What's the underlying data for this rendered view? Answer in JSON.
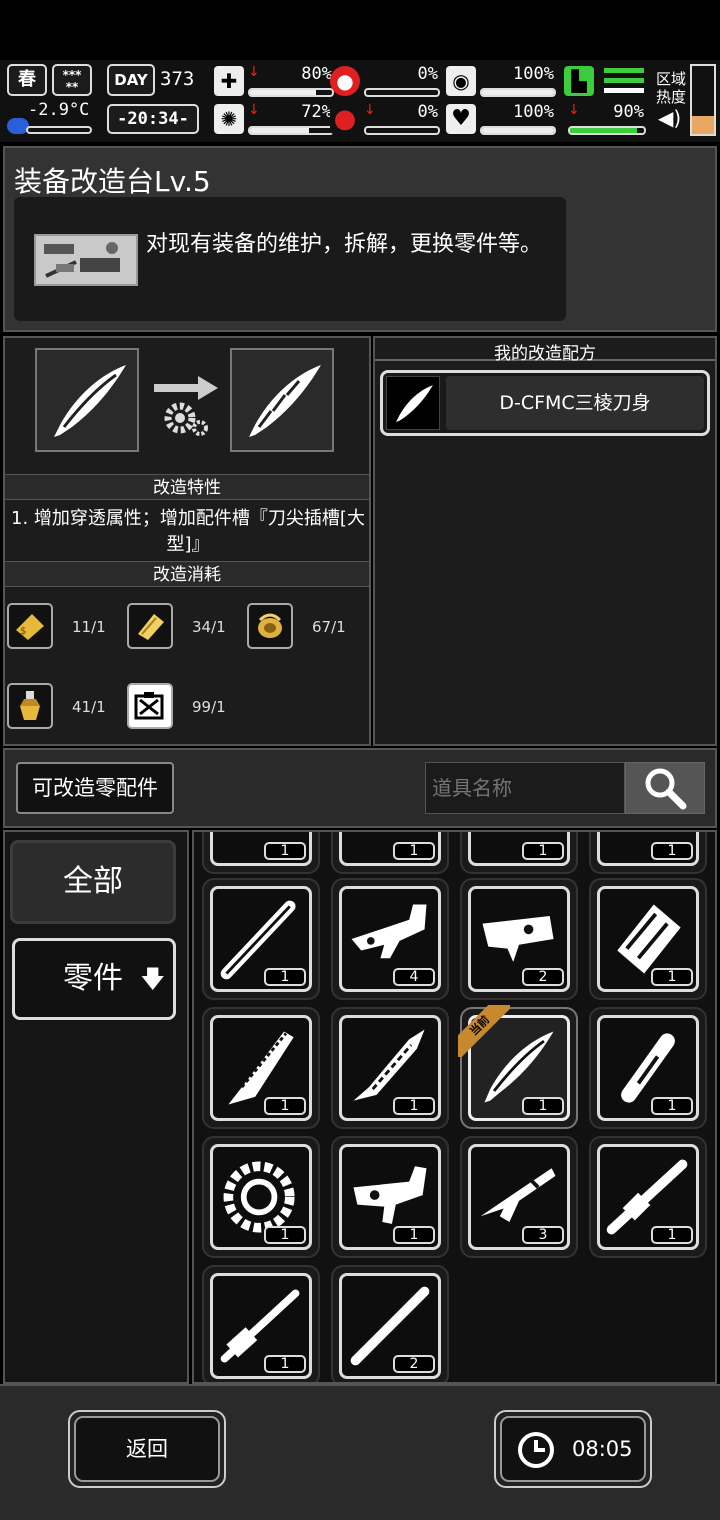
{
  "status": {
    "season": "春",
    "weather_icon": "snowflakes-icon",
    "weather": "***\n**",
    "day_label": "DAY",
    "day": "373",
    "temperature": "-2.9°C",
    "time": "-20:34-",
    "stats": [
      {
        "name": "health",
        "icon": "medkit-icon",
        "value": "80%",
        "fill": 0.8,
        "trend": "down"
      },
      {
        "name": "hunger",
        "icon": "stomach-icon",
        "value": "0%",
        "fill": 0.0,
        "trend": ""
      },
      {
        "name": "fatigue",
        "icon": "mask-icon",
        "value": "100%",
        "fill": 1.0,
        "trend": ""
      },
      {
        "name": "mind",
        "icon": "brain-icon",
        "value": "72%",
        "fill": 0.72,
        "trend": "down"
      },
      {
        "name": "blood",
        "icon": "blood-drop-icon",
        "value": "0%",
        "fill": 0.0,
        "trend": "down"
      },
      {
        "name": "heart",
        "icon": "heart-icon",
        "value": "100%",
        "fill": 1.0,
        "trend": ""
      },
      {
        "name": "stamina",
        "icon": "boot-icon",
        "value": "90%",
        "fill": 0.9,
        "trend": "down"
      }
    ],
    "zone_heat": "区域热度",
    "colors": {
      "accent_red": "#e02020",
      "accent_green": "#3ccc3c",
      "accent_blue": "#2b5fd9"
    }
  },
  "header": {
    "title": "装备改造台Lv.5",
    "description": "对现有装备的维护，拆解，更换零件等。"
  },
  "upgrade": {
    "trait_title": "改造特性",
    "trait_text": "1. 增加穿透属性；增加配件槽『刀尖插槽[大型]』",
    "cost_title": "改造消耗",
    "costs": [
      {
        "icon": "gold-ticket-icon",
        "value": "11/1"
      },
      {
        "icon": "gold-card-icon",
        "value": "34/1"
      },
      {
        "icon": "gold-coil-icon",
        "value": "67/1"
      },
      {
        "icon": "oil-lamp-icon",
        "value": "41/1"
      },
      {
        "icon": "blueprint-icon",
        "value": "99/1"
      }
    ]
  },
  "recipes": {
    "header": "我的改造配方",
    "items": [
      {
        "name": "D-CFMC三棱刀身"
      }
    ]
  },
  "search": {
    "parts_label": "可改造零配件",
    "placeholder": "道具名称"
  },
  "sidebar": {
    "all": "全部",
    "parts": "零件"
  },
  "grid": {
    "top_counts": [
      "1",
      "1",
      "1",
      "1"
    ],
    "current_badge": "当前",
    "items": [
      {
        "icon": "rod-icon",
        "count": "1"
      },
      {
        "icon": "trigger-assembly-icon",
        "count": "4"
      },
      {
        "icon": "trigger-group-icon",
        "count": "2"
      },
      {
        "icon": "canister-icon",
        "count": "1"
      },
      {
        "icon": "serrated-blade-icon",
        "count": "1"
      },
      {
        "icon": "jagged-blade-icon",
        "count": "1"
      },
      {
        "icon": "curved-blade-icon",
        "count": "1",
        "current": true
      },
      {
        "icon": "battery-tube-icon",
        "count": "1"
      },
      {
        "icon": "gear-ring-icon",
        "count": "1"
      },
      {
        "icon": "receiver-icon",
        "count": "1"
      },
      {
        "icon": "rifle-frame-icon",
        "count": "3"
      },
      {
        "icon": "barrel-icon",
        "count": "1"
      },
      {
        "icon": "suppressor-barrel-icon",
        "count": "1"
      },
      {
        "icon": "long-rod-icon",
        "count": "2"
      }
    ]
  },
  "footer": {
    "back": "返回",
    "time": "08:05"
  }
}
